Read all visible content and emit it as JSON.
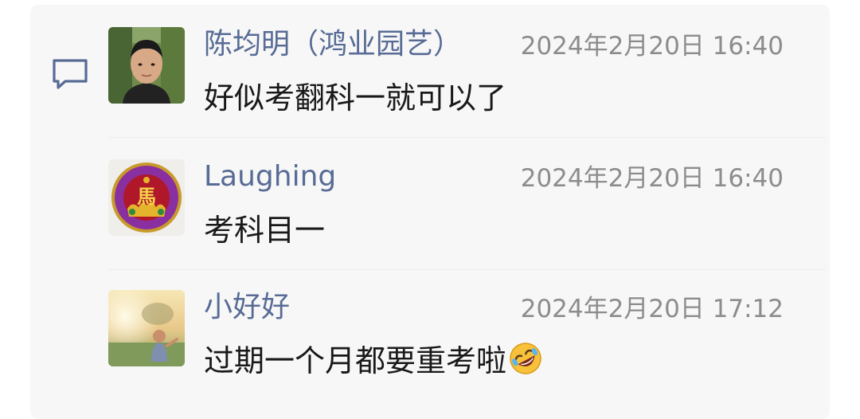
{
  "comments": [
    {
      "name": "陈均明（鸿业园艺）",
      "time": "2024年2月20日 16:40",
      "text": "好似考翻科一就可以了",
      "avatar_icon": "man-photo-avatar"
    },
    {
      "name": "Laughing",
      "time": "2024年2月20日 16:40",
      "text": "考科目一",
      "avatar_icon": "ma-character-medallion-avatar",
      "avatar_glyph": "馬"
    },
    {
      "name": "小好好",
      "time": "2024年2月20日 17:12",
      "text": "过期一个月都要重考啦",
      "avatar_icon": "child-sunset-photo-avatar",
      "trailing_emoji": "rolling-on-floor-laughing-emoji"
    }
  ],
  "colors": {
    "name": "#576b95",
    "time": "#8c8c8c",
    "text": "#191919",
    "panel": "#f7f7f7"
  }
}
